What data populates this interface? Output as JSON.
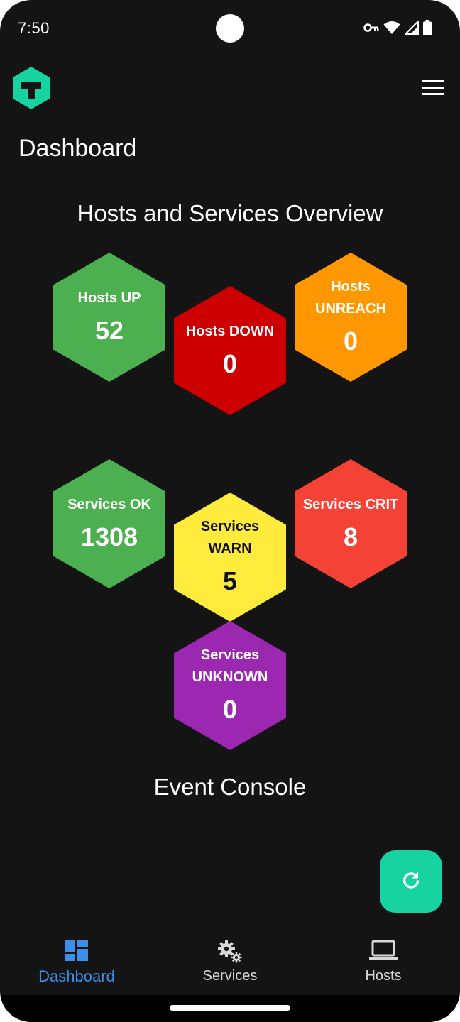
{
  "status_bar": {
    "time": "7:50",
    "icons": [
      "vpn-key-icon",
      "wifi-icon",
      "signal-icon",
      "battery-icon"
    ]
  },
  "app_bar": {
    "logo_icon": "app-logo-icon",
    "menu_icon": "hamburger-menu-icon"
  },
  "page": {
    "title": "Dashboard"
  },
  "overview": {
    "title": "Hosts and Services Overview",
    "hosts": [
      {
        "label": "Hosts UP",
        "value": "52",
        "color": "#4caf50"
      },
      {
        "label": "Hosts DOWN",
        "value": "0",
        "color": "#cc0000"
      },
      {
        "label": "Hosts UNREACH",
        "value": "0",
        "color": "#ff9800"
      }
    ],
    "services": [
      {
        "label": "Services OK",
        "value": "1308",
        "color": "#4caf50"
      },
      {
        "label": "Services WARN",
        "value": "5",
        "color": "#ffeb3b"
      },
      {
        "label": "Services CRIT",
        "value": "8",
        "color": "#f44336"
      },
      {
        "label": "Services UNKNOWN",
        "value": "0",
        "color": "#9c27b0"
      }
    ]
  },
  "event_console": {
    "title": "Event Console"
  },
  "fab": {
    "icon": "refresh-icon",
    "color": "#17d3a0"
  },
  "bottom_nav": {
    "active_color": "#3d8ee8",
    "items": [
      {
        "label": "Dashboard",
        "icon": "dashboard-icon",
        "active": true
      },
      {
        "label": "Services",
        "icon": "gears-icon",
        "active": false
      },
      {
        "label": "Hosts",
        "icon": "laptop-icon",
        "active": false
      }
    ]
  }
}
